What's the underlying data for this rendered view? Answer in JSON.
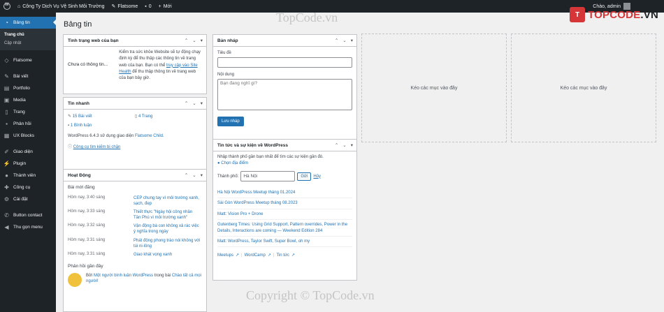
{
  "adminbar": {
    "site_name": "Công Ty Dịch Vụ Vệ Sinh Môi Trường",
    "theme": "Flatsome",
    "comments_count": "0",
    "new_label": "Mới",
    "greeting": "Chào, admin"
  },
  "menu": {
    "dashboard": "Bảng tin",
    "sub_home": "Trang chủ",
    "sub_updates": "Cập nhật",
    "flatsome": "Flatsome",
    "posts": "Bài viết",
    "portfolio": "Portfolio",
    "media": "Media",
    "pages": "Trang",
    "comments": "Phản hồi",
    "ux_blocks": "UX Blocks",
    "appearance": "Giao diện",
    "plugins": "Plugin",
    "users": "Thành viên",
    "tools": "Công cụ",
    "settings": "Cài đặt",
    "button_contact": "Button contact",
    "collapse": "Thu gọn menu"
  },
  "page_title": "Bảng tin",
  "site_health": {
    "title": "Tình trạng web của bạn",
    "status": "Chưa có thông tin...",
    "desc_1": "Kiểm tra sức khỏe Website sẽ tự động chạy định kỳ để thu thập các thông tin về trang web của bạn. Bạn có thể",
    "link": "truy cập vào Site Health",
    "desc_2": "để thu thập thông tin về trang web của bạn bây giờ."
  },
  "at_a_glance": {
    "title": "Tin nhanh",
    "posts": "15 Bài viết",
    "pages": "4 Trang",
    "comments": "1 Bình luận",
    "version_text": "WordPress 6.4.3 sử dụng giao diện",
    "theme_link": "Flatsome Child",
    "search_engine": "Công cụ tìm kiếm bị chặn"
  },
  "activity": {
    "title": "Hoạt Động",
    "recent_label": "Bài mới đăng",
    "items": [
      {
        "date": "Hôm nay, 3:40 sáng",
        "title": "CEP chung tay vì môi trường xanh, sạch, đẹp"
      },
      {
        "date": "Hôm nay, 3:33 sáng",
        "title": "Thiết thực \"Ngày hội công nhân Tân Phú vì môi trường xanh\""
      },
      {
        "date": "Hôm nay, 3:32 sáng",
        "title": "Vận động bà con không xả rác việc ý nghĩa trong ngày"
      },
      {
        "date": "Hôm nay, 3:31 sáng",
        "title": "Phát động phong trào nói không với túi ni-lông"
      },
      {
        "date": "Hôm nay, 3:31 sáng",
        "title": "Giao khát vọng xanh"
      }
    ],
    "comments_label": "Phản hồi gần đây",
    "comment_prefix": "Bởi",
    "comment_author": "Một người bình luận WordPress",
    "comment_mid": "trong bài",
    "comment_post": "Chào tất cả mọi người!"
  },
  "quick_draft": {
    "title": "Bản nháp",
    "title_label": "Tiêu đề",
    "title_value": "",
    "content_label": "Nội dung",
    "content_placeholder": "Bạn đang nghĩ gì?",
    "save_button": "Lưu nháp"
  },
  "events": {
    "title": "Tin tức và sự kiện về WordPress",
    "intro": "Nhập thành phố gần bạn nhất để tìm các sự kiện gần đó.",
    "choose_location": "Chọn địa điểm",
    "city_label": "Thành phố:",
    "city_value": "Hà Nội",
    "submit": "Gửi",
    "cancel": "Hủy",
    "items": [
      "Hà Nội WordPress Meetup tháng 01.2024",
      "Sài Gòn WordPress Meetup tháng 08.2023",
      "Matt: Vision Pro + Drone",
      "Gutenberg Times: Using Grid Support, Pattern overrides, Power in the Details, Interactions are coming — Weekend Edition 284",
      "Matt: WordPress, Taylor Swift, Super Bowl, oh my"
    ],
    "footer_meetups": "Meetups",
    "footer_wordcamp": "WordCamp",
    "footer_news": "Tin tức"
  },
  "drop_zone_label": "Kéo các mục vào đây",
  "watermark": {
    "logo_prefix": "TOPCODE",
    "logo_suffix": ".VN",
    "top_text": "TopCode.vn",
    "bottom_text": "Copyright © TopCode.vn"
  },
  "colors": {
    "admin_bg": "#1d2327",
    "accent": "#2271b1",
    "page_bg": "#f0f0f1"
  }
}
